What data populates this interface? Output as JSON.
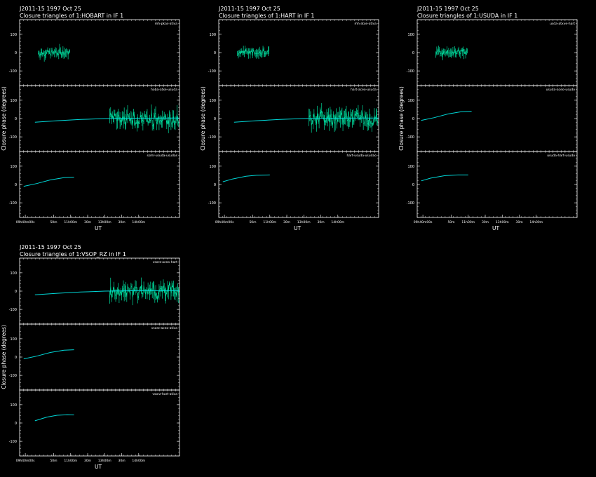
{
  "colors": {
    "background": "#000000",
    "axes": "#ffffff",
    "series": "#00e0a0",
    "model": "#00d8d8"
  },
  "chart_data": [
    {
      "type": "line",
      "title": "J2011-15   1997 Oct 25",
      "subtitle": "Closure triangles of 1:HOBART in IF 1",
      "xlabel": "UT",
      "ylabel": "Closure phase   (degrees)",
      "xlim": [
        9.5,
        14.2
      ],
      "xticks": [
        "09h40m00s",
        "50m",
        "11h00m",
        "30m",
        "13h00m",
        "30m",
        "14h00m"
      ],
      "xtick_values": [
        9.667,
        10.5,
        11.0,
        11.5,
        12.0,
        12.5,
        13.0
      ],
      "ylim": [
        -180,
        180
      ],
      "yticks": [
        100,
        0,
        -100
      ],
      "triangles": [
        {
          "label": "mh-pkas-ativa",
          "model_line": [],
          "noise": {
            "start": 10.05,
            "end": 11.0,
            "amp": 30
          }
        },
        {
          "label": "hoba-atxe-usuda",
          "model_line": [
            [
              9.95,
              -20
            ],
            [
              10.6,
              -12
            ],
            [
              11.3,
              -5
            ],
            [
              12.0,
              0
            ],
            [
              12.8,
              2
            ],
            [
              14.2,
              3
            ]
          ],
          "noise": {
            "start": 12.15,
            "end": 14.2,
            "amp": 60
          }
        },
        {
          "label": "ssmr-usuda-usudas",
          "model_line": [
            [
              9.62,
              -10
            ],
            [
              10.0,
              5
            ],
            [
              10.4,
              25
            ],
            [
              10.8,
              37
            ],
            [
              11.1,
              40
            ]
          ],
          "noise": null
        }
      ]
    },
    {
      "type": "line",
      "title": "J2011-15   1997 Oct 25",
      "subtitle": "Closure triangles of 1:HART in IF 1",
      "xlabel": "UT",
      "ylabel": "Closure phase   (degrees)",
      "xlim": [
        9.5,
        14.2
      ],
      "xticks": [
        "09h40m00s",
        "50m",
        "11h00m",
        "30m",
        "13h00m",
        "30m",
        "14h00m"
      ],
      "xtick_values": [
        9.667,
        10.5,
        11.0,
        11.5,
        12.0,
        12.5,
        13.0
      ],
      "ylim": [
        -180,
        180
      ],
      "yticks": [
        100,
        0,
        -100
      ],
      "triangles": [
        {
          "label": "mh-atxe-ativa",
          "model_line": [],
          "noise": {
            "start": 10.05,
            "end": 11.0,
            "amp": 30
          }
        },
        {
          "label": "hart-aceo-usuda",
          "model_line": [
            [
              9.95,
              -20
            ],
            [
              10.6,
              -12
            ],
            [
              11.3,
              -5
            ],
            [
              12.0,
              0
            ],
            [
              12.8,
              2
            ],
            [
              14.2,
              3
            ]
          ],
          "noise": {
            "start": 12.15,
            "end": 14.2,
            "amp": 60
          }
        },
        {
          "label": "hart-usuda-usudao",
          "model_line": [
            [
              9.62,
              15
            ],
            [
              9.9,
              30
            ],
            [
              10.3,
              45
            ],
            [
              10.6,
              50
            ],
            [
              11.0,
              52
            ]
          ],
          "noise": null
        }
      ]
    },
    {
      "type": "line",
      "title": "J2011-15   1997 Oct 25",
      "subtitle": "Closure triangles of 1:USUDA in IF 1",
      "xlabel": "UT",
      "ylabel": "Closure phase   (degrees)",
      "xlim": [
        9.5,
        14.2
      ],
      "xticks": [
        "09h40m00s",
        "50m",
        "11h00m",
        "30m",
        "13h00m",
        "30m",
        "14h00m"
      ],
      "xtick_values": [
        9.667,
        10.5,
        11.0,
        11.5,
        12.0,
        12.5,
        13.0
      ],
      "ylim": [
        -180,
        180
      ],
      "yticks": [
        100,
        0,
        -100
      ],
      "triangles": [
        {
          "label": "usda-atxve-hart",
          "model_line": [],
          "noise": {
            "start": 10.05,
            "end": 11.0,
            "amp": 30
          }
        },
        {
          "label": "usuda-aceo-usudo",
          "model_line": [
            [
              9.62,
              -10
            ],
            [
              10.0,
              5
            ],
            [
              10.4,
              25
            ],
            [
              10.8,
              37
            ],
            [
              11.1,
              40
            ]
          ],
          "noise": null
        },
        {
          "label": "usuda-hart-usudo",
          "model_line": [
            [
              9.62,
              20
            ],
            [
              9.9,
              35
            ],
            [
              10.3,
              48
            ],
            [
              10.7,
              52
            ],
            [
              11.0,
              52
            ]
          ],
          "noise": null
        }
      ]
    },
    {
      "type": "line",
      "title": "J2011-15   1997 Oct 25",
      "subtitle": "Closure triangles of 1:VSOP_RZ in IF 1",
      "xlabel": "UT",
      "ylabel": "Closure phase   (degrees)",
      "xlim": [
        9.5,
        14.2
      ],
      "xticks": [
        "09h40m00s",
        "50m",
        "11h00m",
        "30m",
        "13h00m",
        "30m",
        "14h00m"
      ],
      "xtick_values": [
        9.667,
        10.5,
        11.0,
        11.5,
        12.0,
        12.5,
        13.0
      ],
      "ylim": [
        -180,
        180
      ],
      "yticks": [
        100,
        0,
        -100
      ],
      "triangles": [
        {
          "label": "vsorz-aceo-hart",
          "model_line": [
            [
              9.95,
              -20
            ],
            [
              10.6,
              -12
            ],
            [
              11.3,
              -5
            ],
            [
              12.0,
              0
            ],
            [
              12.8,
              2
            ],
            [
              14.2,
              3
            ]
          ],
          "noise": {
            "start": 12.15,
            "end": 14.2,
            "amp": 60
          }
        },
        {
          "label": "vsorz-aceo-ativa",
          "model_line": [
            [
              9.62,
              -10
            ],
            [
              10.0,
              5
            ],
            [
              10.4,
              25
            ],
            [
              10.8,
              37
            ],
            [
              11.1,
              40
            ]
          ],
          "noise": null
        },
        {
          "label": "vsorz-hart-ativa",
          "model_line": [
            [
              9.95,
              12
            ],
            [
              10.3,
              32
            ],
            [
              10.6,
              42
            ],
            [
              10.9,
              45
            ],
            [
              11.1,
              44
            ]
          ],
          "noise": null
        }
      ]
    }
  ]
}
